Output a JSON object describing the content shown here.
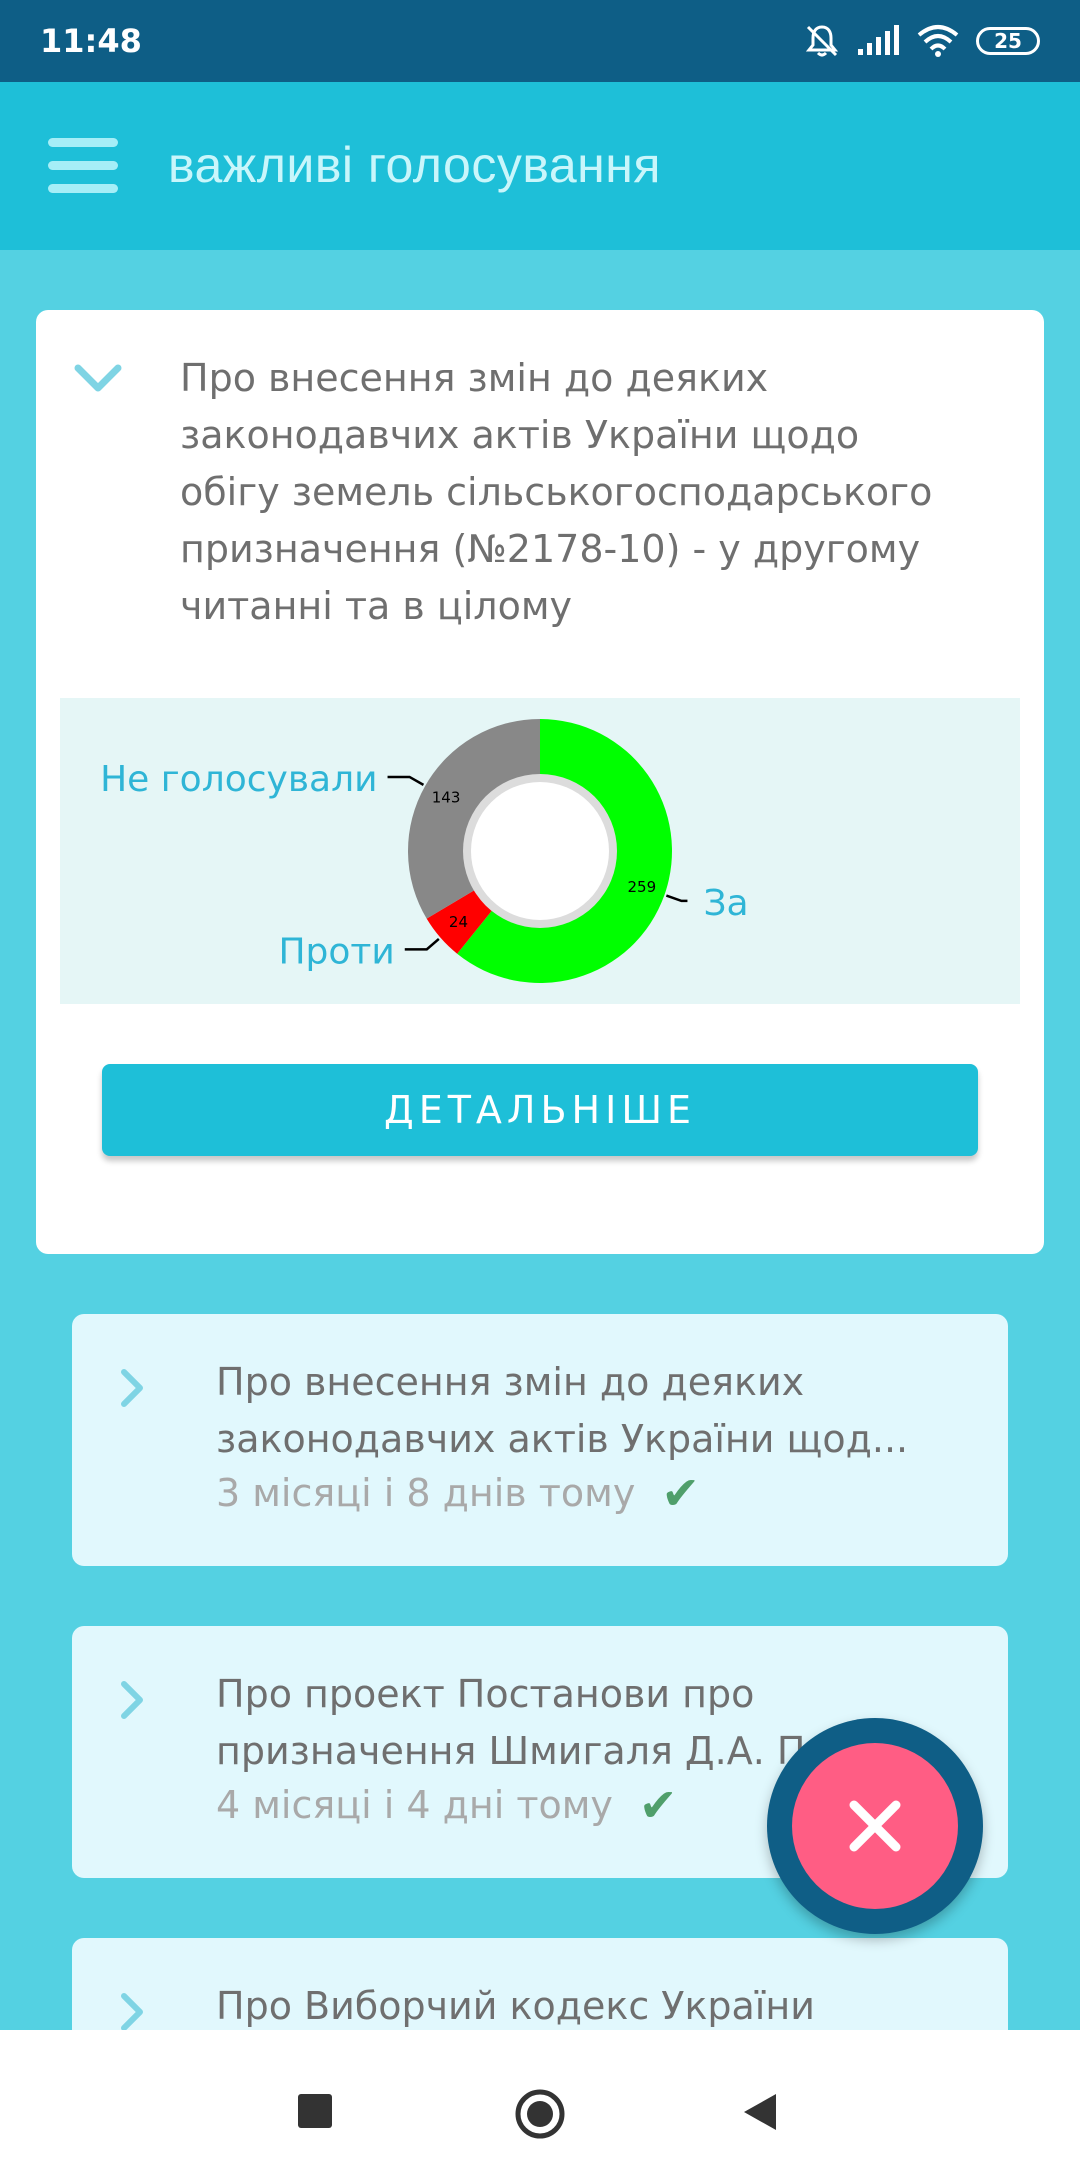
{
  "status_bar": {
    "time": "11:48",
    "battery": "25"
  },
  "app_bar": {
    "title": "важливі голосування"
  },
  "expanded_card": {
    "title": [
      "Про внесення змін до деяких",
      "законодавчих актів України щодо",
      "обігу земель сільськогосподарського",
      "призначення (№2178-10) - у другому",
      "читанні та в цілому"
    ],
    "button_label": "ДЕТАЛЬНІШЕ"
  },
  "chart_data": {
    "type": "pie",
    "categories": [
      "За",
      "Проти",
      "Не голосували"
    ],
    "values": [
      259,
      24,
      143
    ],
    "colors": [
      "#00ff00",
      "#ff0000",
      "#888888"
    ],
    "title": ""
  },
  "items": [
    {
      "title_line1": "Про внесення змін до деяких",
      "title_line2": "законодавчих актів України щод...",
      "date": "3 місяці і 8 днів тому",
      "status_icon": "check-icon"
    },
    {
      "title_line1": "Про проект Постанови про",
      "title_line2": "призначення Шмигаля Д.А. П",
      "date": "4 місяці і 4 дні тому",
      "status_icon": "check-icon"
    },
    {
      "title_line1": "Про Виборчий кодекс України",
      "title_line2": "",
      "date": "",
      "status_icon": ""
    }
  ]
}
